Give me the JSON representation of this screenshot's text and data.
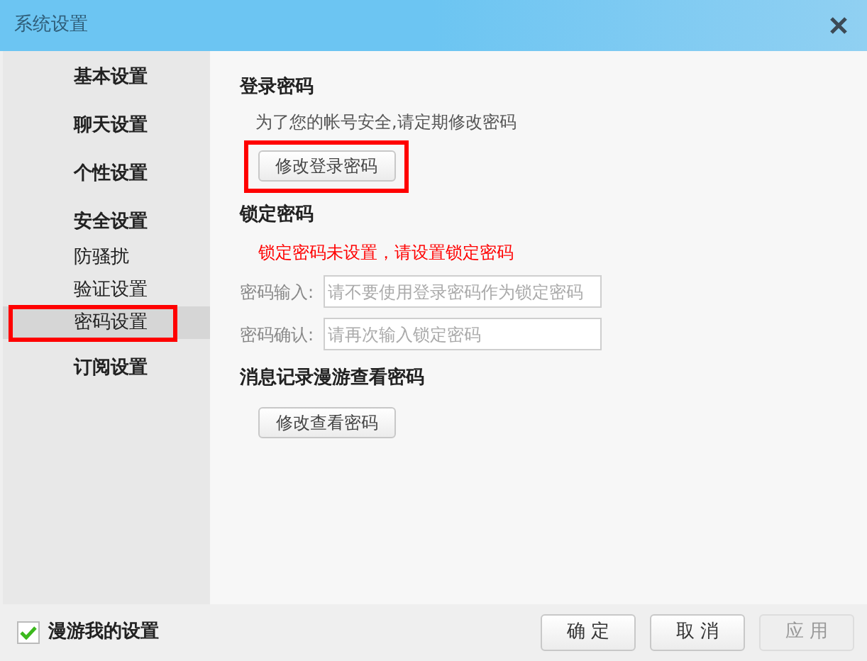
{
  "window": {
    "title": "系统设置"
  },
  "sidebar": {
    "items": [
      {
        "label": "基本设置",
        "selected": false,
        "highlighted": false
      },
      {
        "label": "聊天设置",
        "selected": false,
        "highlighted": false
      },
      {
        "label": "个性设置",
        "selected": false,
        "highlighted": false
      },
      {
        "label": "安全设置",
        "selected": false,
        "highlighted": false,
        "children": [
          {
            "label": "防骚扰",
            "selected": false,
            "highlighted": false
          },
          {
            "label": "验证设置",
            "selected": false,
            "highlighted": false
          },
          {
            "label": "密码设置",
            "selected": true,
            "highlighted": true
          }
        ]
      },
      {
        "label": "订阅设置",
        "selected": false,
        "highlighted": false
      }
    ]
  },
  "login_password": {
    "heading": "登录密码",
    "description": "为了您的帐号安全,请定期修改密码",
    "button": {
      "label": "修改登录密码",
      "highlighted": true
    }
  },
  "lock_password": {
    "heading": "锁定密码",
    "warning": "锁定密码未设置，请设置锁定密码",
    "fields": [
      {
        "label": "密码输入:",
        "placeholder": "请不要使用登录密码作为锁定密码"
      },
      {
        "label": "密码确认:",
        "placeholder": "请再次输入锁定密码"
      }
    ]
  },
  "history_password": {
    "heading": "消息记录漫游查看密码",
    "button": {
      "label": "修改查看密码",
      "highlighted": false
    }
  },
  "footer": {
    "roam": {
      "label": "漫游我的设置",
      "checked": true
    },
    "buttons": [
      {
        "label": "确 定",
        "disabled": false
      },
      {
        "label": "取 消",
        "disabled": false
      },
      {
        "label": "应 用",
        "disabled": true
      }
    ]
  }
}
